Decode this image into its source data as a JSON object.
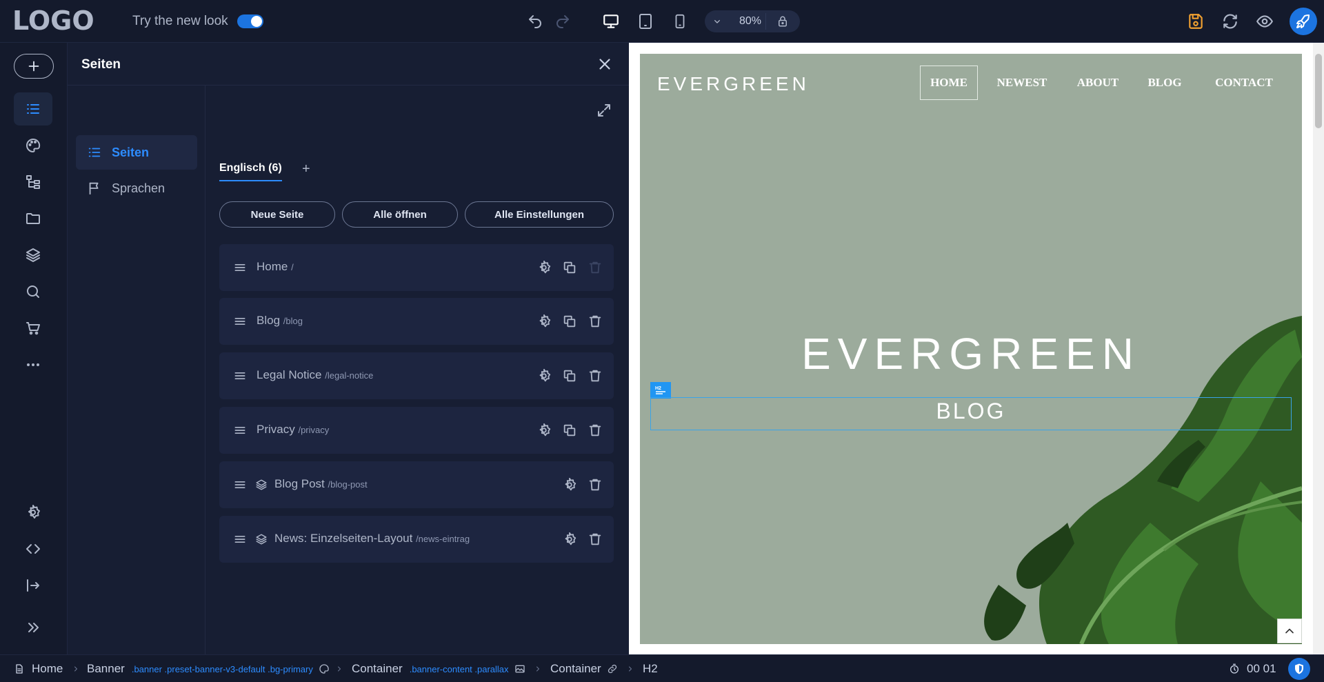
{
  "topbar": {
    "logo": "LOGO",
    "new_look_label": "Try the new look",
    "zoom": "80%",
    "icons": [
      "undo-icon",
      "redo-icon",
      "desktop-icon",
      "tablet-icon",
      "mobile-icon",
      "chevron-down-icon",
      "lock-icon",
      "save-icon",
      "refresh-icon",
      "eye-icon",
      "rocket-icon"
    ]
  },
  "sidebar": {
    "items": [
      "add-icon",
      "pages-list-icon",
      "palette-icon",
      "tree-icon",
      "folder-icon",
      "layers-icon",
      "search-icon",
      "cart-icon",
      "more-icon",
      "settings-icon",
      "code-icon",
      "logout-icon",
      "expand-icon"
    ]
  },
  "panel": {
    "title": "Seiten",
    "subnav": [
      {
        "label": "Seiten"
      },
      {
        "label": "Sprachen"
      }
    ],
    "tab": "Englisch (6)",
    "tab_add": "+",
    "buttons": {
      "new_page": "Neue Seite",
      "open_all": "Alle öffnen",
      "all_settings": "Alle Einstellungen"
    },
    "pages": [
      {
        "name": "Home",
        "slug": "/"
      },
      {
        "name": "Blog",
        "slug": "/blog"
      },
      {
        "name": "Legal Notice",
        "slug": "/legal-notice"
      },
      {
        "name": "Privacy",
        "slug": "/privacy"
      },
      {
        "name": "Blog Post",
        "slug": "/blog-post"
      },
      {
        "name": "News: Einzelseiten-Layout",
        "slug": "/news-eintrag"
      }
    ]
  },
  "preview": {
    "site_logo": "EVERGREEN",
    "nav": [
      "HOME",
      "NEWEST",
      "ABOUT",
      "BLOG",
      "CONTACT"
    ],
    "hero_title": "EVERGREEN",
    "hero_subtitle": "BLOG"
  },
  "breadcrumb": {
    "items": [
      {
        "label": "Home",
        "cls": ""
      },
      {
        "label": "Banner",
        "cls": ".banner .preset-banner-v3-default .bg-primary"
      },
      {
        "label": "Container",
        "cls": ".banner-content .parallax"
      },
      {
        "label": "Container",
        "cls": ""
      },
      {
        "label": "H2",
        "cls": ""
      }
    ],
    "timer": "00 01"
  },
  "colors": {
    "accent": "#1c74e0",
    "panel_bg": "#171e33",
    "preview_bg": "#9cab9c"
  }
}
